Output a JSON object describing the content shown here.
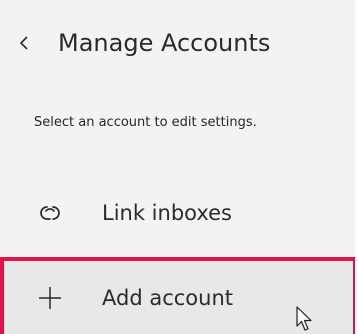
{
  "header": {
    "back_icon": "chevron-left-icon",
    "title": "Manage Accounts"
  },
  "subtitle": "Select an account to edit settings.",
  "menu": [
    {
      "label": "Link inboxes",
      "icon": "link-icon"
    },
    {
      "label": "Add account",
      "icon": "plus-icon",
      "highlighted": true
    }
  ],
  "colors": {
    "panel_bg": "#f3f3f3",
    "highlight_border": "#e3124d",
    "hover_bg": "#e8e8e8",
    "text": "#2b2b2b"
  }
}
